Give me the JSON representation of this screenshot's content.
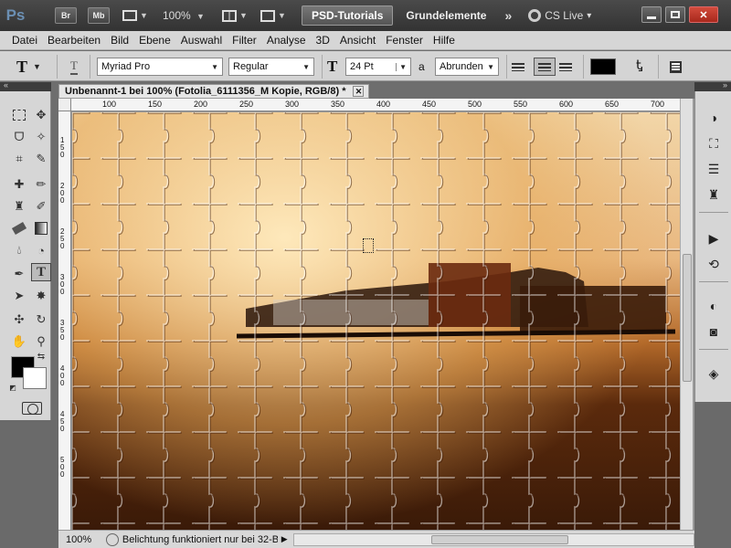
{
  "titlebar": {
    "app_logo": "Ps",
    "bridge_btn": "Br",
    "minibridge_btn": "Mb",
    "zoom": "100%",
    "workspace_active": "PSD-Tutorials",
    "workspace_next": "Grundelemente",
    "overflow": "»",
    "cslive": "CS Live",
    "cslive_dropdown": "▾"
  },
  "menubar": {
    "items": [
      "Datei",
      "Bearbeiten",
      "Bild",
      "Ebene",
      "Auswahl",
      "Filter",
      "Analyse",
      "3D",
      "Ansicht",
      "Fenster",
      "Hilfe"
    ]
  },
  "options": {
    "tool_glyph": "T",
    "font_family": "Myriad Pro",
    "font_style": "Regular",
    "size_glyph": "T",
    "font_size": "24 Pt",
    "aa_glyph": "a",
    "antialias": "Abrunden",
    "text_color": "#000000"
  },
  "document": {
    "tab_title": "Unbenannt-1 bei 100% (Fotolia_6111356_M Kopie, RGB/8) *",
    "close": "✕"
  },
  "rulers": {
    "top": [
      "100",
      "150",
      "200",
      "250",
      "300",
      "350",
      "400",
      "450",
      "500",
      "550",
      "600",
      "650",
      "700"
    ],
    "left": [
      "1\n5\n0",
      "2\n0\n0",
      "2\n5\n0",
      "3\n0\n0",
      "3\n5\n0",
      "4\n0\n0",
      "4\n5\n0",
      "5\n0\n0"
    ]
  },
  "status": {
    "zoom": "100%",
    "message": "Belichtung funktioniert nur bei 32-Bit",
    "arrow": "▶"
  },
  "colors": {
    "foreground": "#000000",
    "background": "#ffffff",
    "workspace_active_bg": "#5a5a5a",
    "close_button": "#c0392b"
  }
}
